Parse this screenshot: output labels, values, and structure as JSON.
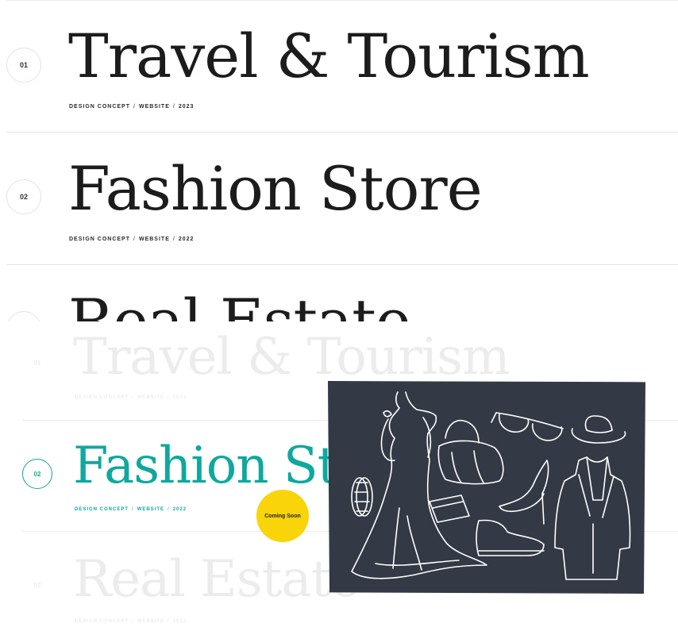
{
  "projects": [
    {
      "number": "01",
      "title": "Travel & Tourism",
      "meta": [
        "DESIGN CONCEPT",
        "WEBSITE",
        "2023"
      ]
    },
    {
      "number": "02",
      "title": "Fashion Store",
      "meta": [
        "DESIGN CONCEPT",
        "WEBSITE",
        "2022"
      ]
    },
    {
      "number": "03",
      "title": "Real Estate",
      "meta": [
        "DESIGN CONCEPT",
        "WEBSITE",
        "2022"
      ]
    }
  ],
  "separator": "/",
  "hover_state": {
    "active_index": 1,
    "accent_color": "#0fa89d",
    "badge_label": "Coming Soon",
    "badge_color": "#f9d40a",
    "preview_background": "#333a45",
    "preview_icons": [
      "evening-gown-icon",
      "handbag-icon",
      "sunglasses-icon",
      "cowboy-hat-icon",
      "high-heel-icon",
      "bracelet-icon",
      "wallet-icon",
      "boot-icon",
      "blazer-icon"
    ]
  }
}
